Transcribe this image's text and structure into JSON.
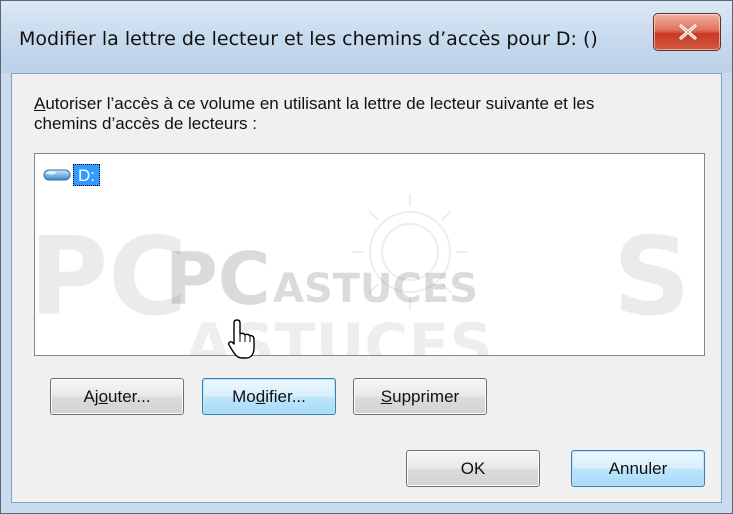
{
  "window": {
    "title": "Modifier la lettre de lecteur et les chemins d’accès pour D: ()",
    "close_glyph": "✕"
  },
  "description": {
    "line1_accel": "A",
    "line1_rest": "utoriser l’accès à ce volume en utilisant la lettre de lecteur suivante et les",
    "line2": "chemins d’accès de lecteurs :"
  },
  "paths_list": {
    "items": [
      {
        "label": "D:",
        "icon": "drive-icon",
        "selected": true
      }
    ]
  },
  "buttons": {
    "add": {
      "pre": "Aj",
      "accel": "o",
      "post": "uter..."
    },
    "modify": {
      "pre": "Mo",
      "accel": "d",
      "post": "ifier..."
    },
    "delete": {
      "pre": "",
      "accel": "S",
      "post": "upprimer"
    },
    "ok": "OK",
    "cancel": "Annuler"
  },
  "watermark": {
    "text_big": "PC",
    "text_small": "ASTUCES",
    "text_bottom": "ASTUCES"
  },
  "colors": {
    "selection": "#3399ff",
    "close_button": "#c73a22",
    "default_button_border": "#3c7fb1"
  }
}
